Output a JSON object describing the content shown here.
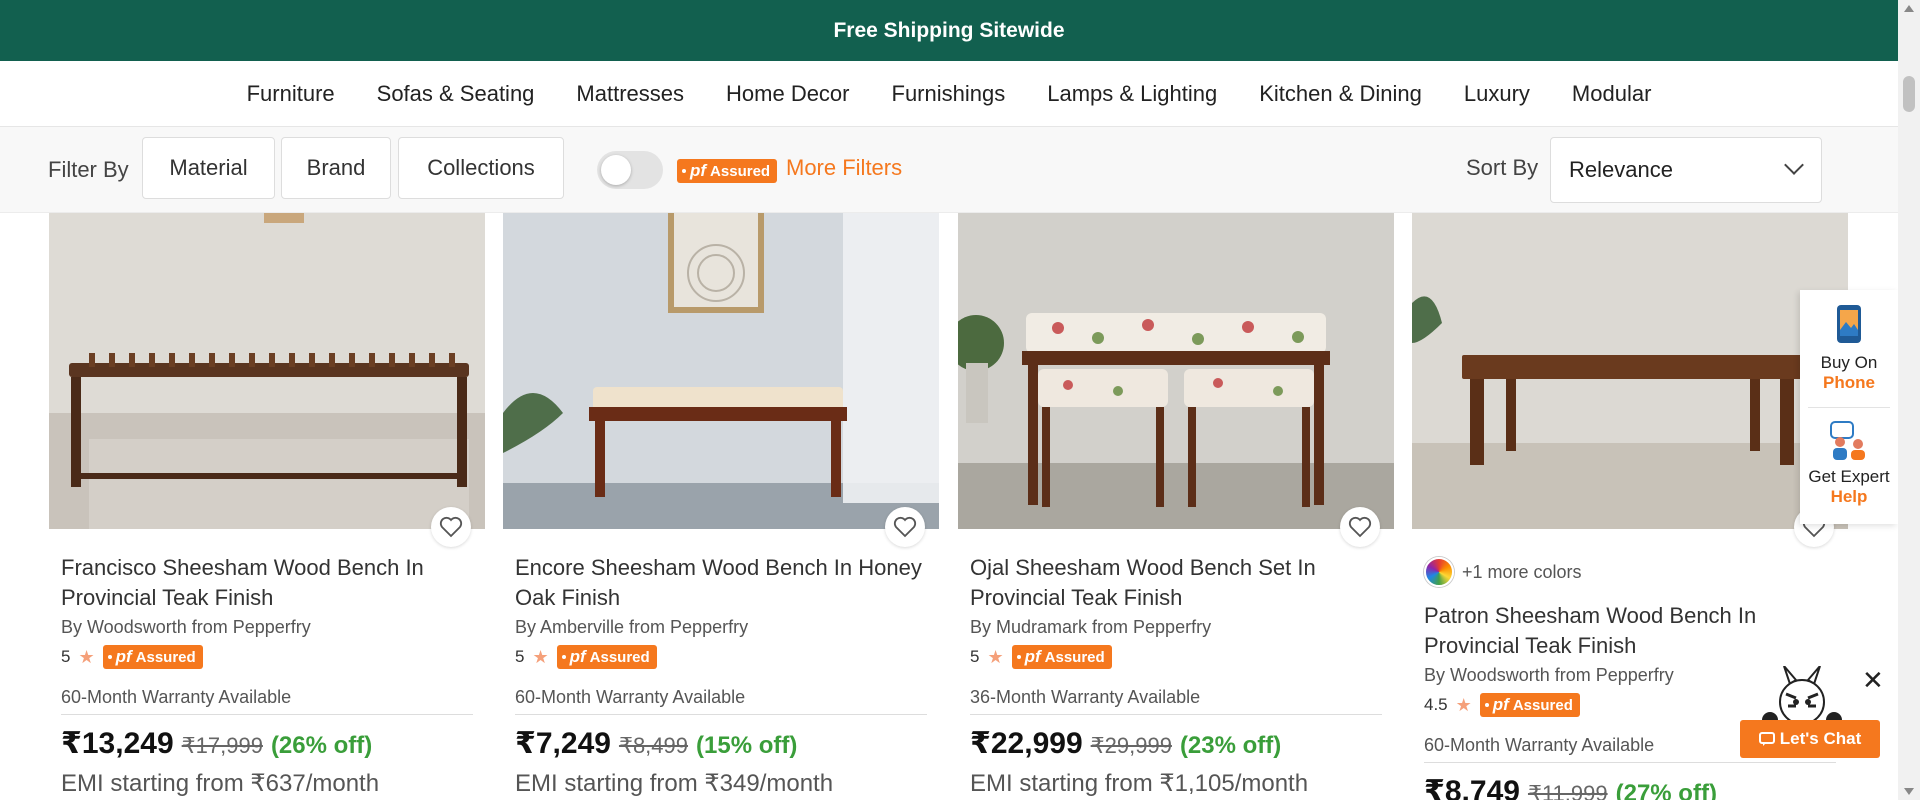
{
  "banner": {
    "text": "Free Shipping Sitewide"
  },
  "nav": {
    "items": [
      "Furniture",
      "Sofas & Seating",
      "Mattresses",
      "Home Decor",
      "Furnishings",
      "Lamps & Lighting",
      "Kitchen & Dining",
      "Luxury",
      "Modular"
    ]
  },
  "filters": {
    "label": "Filter By",
    "buttons": [
      "Material",
      "Brand",
      "Collections"
    ],
    "toggle_on": false,
    "pf_assured_prefix": "pf",
    "pf_assured_text": "Assured",
    "more_filters": "More Filters",
    "sort_label": "Sort By",
    "sort_value": "Relevance"
  },
  "products": [
    {
      "title": "Francisco Sheesham Wood Bench In Provincial Teak Finish",
      "brand": "By Woodsworth from Pepperfry",
      "rating": "5",
      "warranty": "60-Month Warranty Available",
      "price": "₹13,249",
      "mrp": "₹17,999",
      "discount": "(26% off)",
      "emi": "EMI starting from ₹637/month"
    },
    {
      "title": "Encore Sheesham Wood Bench In Honey Oak Finish",
      "brand": "By Amberville from Pepperfry",
      "rating": "5",
      "warranty": "60-Month Warranty Available",
      "price": "₹7,249",
      "mrp": "₹8,499",
      "discount": "(15% off)",
      "emi": "EMI starting from ₹349/month"
    },
    {
      "title": "Ojal Sheesham Wood Bench Set In Provincial Teak Finish",
      "brand": "By Mudramark from Pepperfry",
      "rating": "5",
      "warranty": "36-Month Warranty Available",
      "price": "₹22,999",
      "mrp": "₹29,999",
      "discount": "(23% off)",
      "emi": "EMI starting from ₹1,105/month"
    },
    {
      "more_colors": "+1 more colors",
      "title": "Patron Sheesham Wood Bench In Provincial Teak Finish",
      "brand": "By Woodsworth from Pepperfry",
      "rating": "4.5",
      "warranty": "60-Month Warranty Available",
      "price": "₹8,749",
      "mrp": "₹11,999",
      "discount": "(27% off)"
    }
  ],
  "side_widget": {
    "buy_line1": "Buy On",
    "buy_line2": "Phone",
    "expert_line1": "Get Expert",
    "expert_line2": "Help"
  },
  "chat": {
    "label": "Let's Chat",
    "close": "✕"
  },
  "colors": {
    "banner": "#12604f",
    "accent": "#f5781e",
    "discount": "#3a9e3a"
  }
}
